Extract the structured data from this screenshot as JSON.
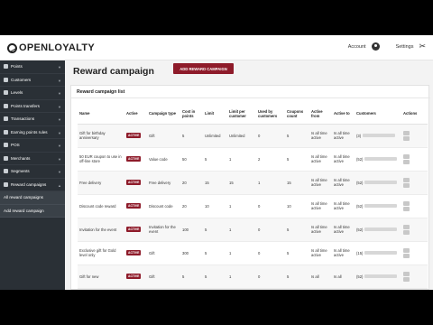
{
  "brand": {
    "logo_text": "OPENLOYALTY"
  },
  "topbar": {
    "account_label": "Account",
    "settings_label": "Settings"
  },
  "sidebar": {
    "items": [
      {
        "label": "Points",
        "active": false
      },
      {
        "label": "Customers",
        "active": false
      },
      {
        "label": "Levels",
        "active": false
      },
      {
        "label": "Points transfers",
        "active": false
      },
      {
        "label": "Transactions",
        "active": false
      },
      {
        "label": "Earning points rules",
        "active": false
      },
      {
        "label": "POS",
        "active": false
      },
      {
        "label": "Merchants",
        "active": false
      },
      {
        "label": "Segments",
        "active": false
      },
      {
        "label": "Reward campaigns",
        "active": true
      }
    ],
    "subitems": [
      {
        "label": "All reward campaigns"
      },
      {
        "label": "Add reward campaign"
      }
    ]
  },
  "main": {
    "title": "Reward campaign",
    "add_button": "ADD REWARD CAMPAIGN",
    "card_title": "Reward campaign list"
  },
  "table": {
    "columns": [
      "Name",
      "Active",
      "Campaign type",
      "Cost in points",
      "Limit",
      "Limit per customer",
      "Used by customers",
      "Coupons count",
      "Active from",
      "Active to",
      "Customers",
      "Actions"
    ],
    "rows": [
      {
        "name": "Gift for birthday anniversary",
        "active": "ACTIVE",
        "type": "Gift",
        "cost": "5",
        "limit": "Unlimited",
        "limit_per": "Unlimited",
        "used": "0",
        "coupons": "5",
        "from": "Is all time active",
        "to": "Is all time active",
        "customers": "(3)"
      },
      {
        "name": "50 EUR coupon to use in off-line store",
        "active": "ACTIVE",
        "type": "Value code",
        "cost": "50",
        "limit": "5",
        "limit_per": "1",
        "used": "2",
        "coupons": "5",
        "from": "Is all time active",
        "to": "Is all time active",
        "customers": "(52)"
      },
      {
        "name": "Free delivery",
        "active": "ACTIVE",
        "type": "Free delivery",
        "cost": "20",
        "limit": "15",
        "limit_per": "15",
        "used": "1",
        "coupons": "15",
        "from": "Is all time active",
        "to": "Is all time active",
        "customers": "(52)"
      },
      {
        "name": "Discount code reward",
        "active": "ACTIVE",
        "type": "Discount code",
        "cost": "20",
        "limit": "10",
        "limit_per": "1",
        "used": "0",
        "coupons": "10",
        "from": "Is all time active",
        "to": "Is all time active",
        "customers": "(52)"
      },
      {
        "name": "Invitation for the event",
        "active": "ACTIVE",
        "type": "Invitation for the event",
        "cost": "100",
        "limit": "5",
        "limit_per": "1",
        "used": "0",
        "coupons": "5",
        "from": "Is all time active",
        "to": "Is all time active",
        "customers": "(52)"
      },
      {
        "name": "Exclusive gift for Gold level only",
        "active": "ACTIVE",
        "type": "Gift",
        "cost": "300",
        "limit": "5",
        "limit_per": "1",
        "used": "0",
        "coupons": "5",
        "from": "Is all time active",
        "to": "Is all time active",
        "customers": "(15)"
      },
      {
        "name": "Gift for new",
        "active": "ACTIVE",
        "type": "Gift",
        "cost": "5",
        "limit": "5",
        "limit_per": "1",
        "used": "0",
        "coupons": "5",
        "from": "Is all",
        "to": "Is all",
        "customers": "(52)"
      }
    ]
  }
}
